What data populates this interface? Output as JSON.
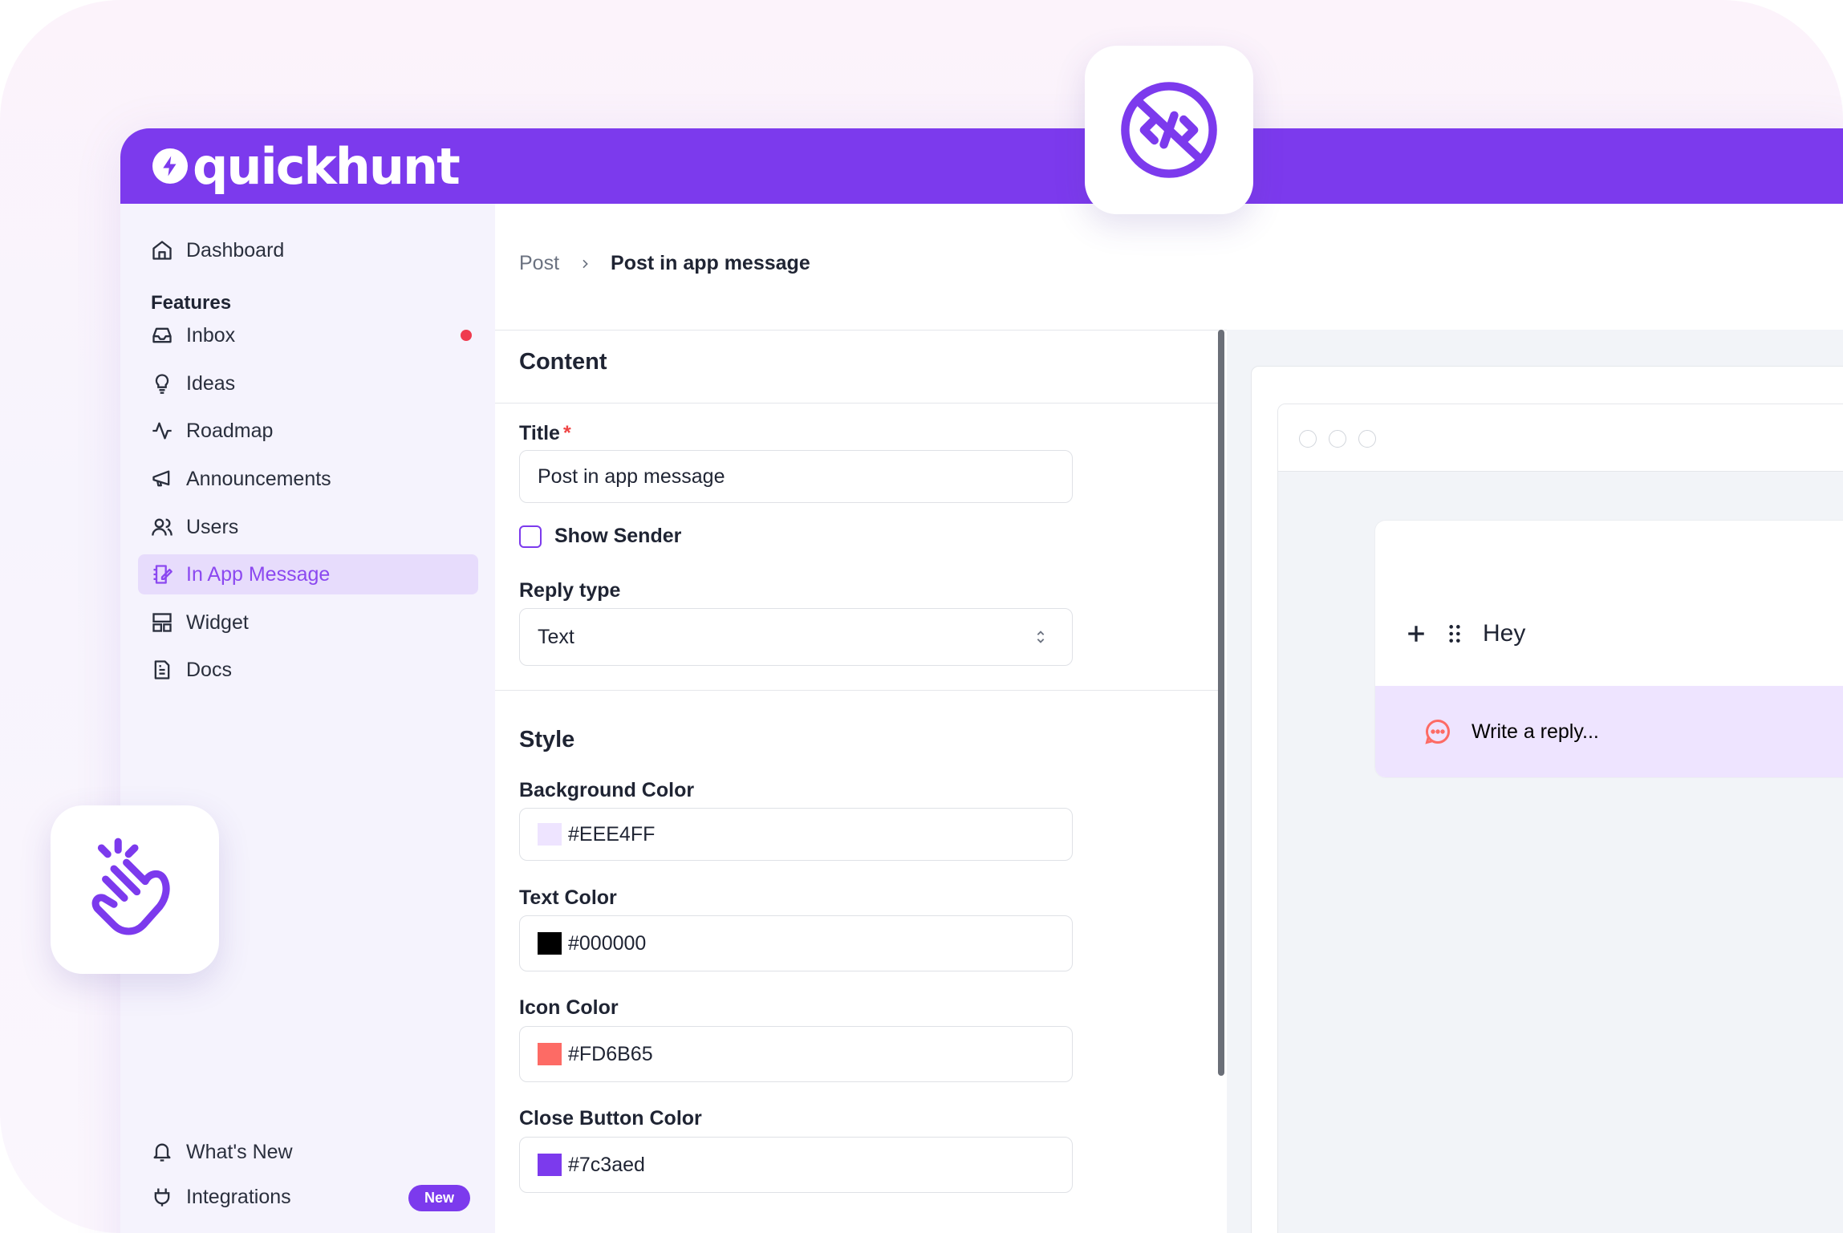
{
  "brand": {
    "name": "quickhunt",
    "accent_color": "#7c3aed"
  },
  "sidebar": {
    "dashboard": {
      "label": "Dashboard",
      "icon": "home-icon"
    },
    "features_heading": "Features",
    "items": [
      {
        "label": "Inbox",
        "icon": "inbox-icon",
        "has_dot": true
      },
      {
        "label": "Ideas",
        "icon": "lightbulb-icon"
      },
      {
        "label": "Roadmap",
        "icon": "activity-icon"
      },
      {
        "label": "Announcements",
        "icon": "megaphone-icon"
      },
      {
        "label": "Users",
        "icon": "users-icon"
      },
      {
        "label": "In App Message",
        "icon": "notebook-pen-icon",
        "active": true
      },
      {
        "label": "Widget",
        "icon": "layout-icon"
      },
      {
        "label": "Docs",
        "icon": "file-text-icon"
      }
    ],
    "whats_new": "What's New",
    "integrations": "Integrations",
    "new_badge": "New"
  },
  "breadcrumb": {
    "parent": "Post",
    "current": "Post in app message"
  },
  "form": {
    "content_heading": "Content",
    "title_label": "Title",
    "title_required": "*",
    "title_value": "Post in app message",
    "show_sender_label": "Show Sender",
    "show_sender_checked": false,
    "reply_type_label": "Reply type",
    "reply_type_value": "Text",
    "style_heading": "Style",
    "colors": [
      {
        "label": "Background Color",
        "value": "#EEE4FF",
        "swatch": "#EEE4FF"
      },
      {
        "label": "Text Color",
        "value": "#000000",
        "swatch": "#000000"
      },
      {
        "label": "Icon Color",
        "value": "#FD6B65",
        "swatch": "#FD6B65"
      },
      {
        "label": "Close Button Color",
        "value": "#7c3aed",
        "swatch": "#7c3aed"
      }
    ]
  },
  "preview": {
    "message_text": "Hey",
    "reply_placeholder": "Write a reply..."
  },
  "floating_icons": [
    "no-code-icon",
    "snap-fingers-icon"
  ]
}
